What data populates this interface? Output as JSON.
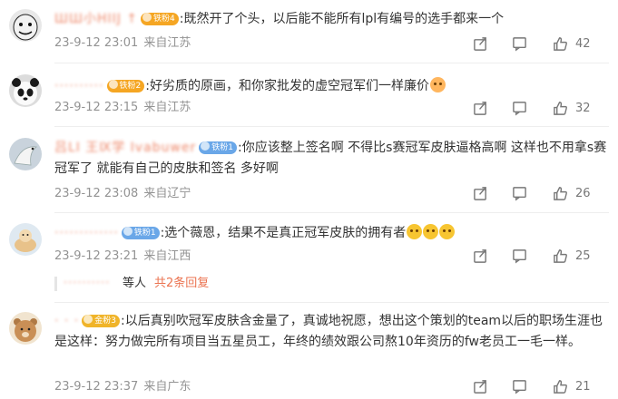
{
  "comments": [
    {
      "username": "ШШ小HIIJ ↑",
      "badge_label": "铁粉4",
      "badge_color": "#f5a623",
      "text": ":既然开了个头，以后能不能所有lpl有编号的选手都来一个",
      "time": "23-9-12 23:01",
      "location": "来自江苏",
      "likes": "42",
      "avatar_icon": "meme-face-avatar"
    },
    {
      "username": "··········",
      "badge_label": "铁粉2",
      "badge_color": "#f5a623",
      "text": ":好劣质的原画，和你家批发的虚空冠军们一样廉价",
      "emoji": "blush-emoji",
      "time": "23-9-12 23:15",
      "location": "来自江苏",
      "likes": "32",
      "avatar_icon": "panda-avatar"
    },
    {
      "username": "吕LI 王Ⅸ学 Ivabuwer",
      "badge_label": "铁粉1",
      "badge_color": "#6aa7e8",
      "text": ":你应该整上签名啊 不得比s赛冠军皮肤逼格高啊  这样也不用拿s赛冠军了 就能有自己的皮肤和签名 多好啊",
      "time": "23-9-12 23:08",
      "location": "来自辽宁",
      "likes": "26",
      "avatar_icon": "bird-avatar"
    },
    {
      "username": "·············",
      "badge_label": "铁粉1",
      "badge_color": "#6aa7e8",
      "text": ":选个薇恩，结果不是真正冠军皮肤的拥有者",
      "emoji_count": 3,
      "time": "23-9-12 23:21",
      "location": "来自江西",
      "likes": "25",
      "avatar_icon": "cartoon-avatar"
    },
    {
      "username": "·   ·   ·",
      "badge_label": "金粉3",
      "badge_color": "#f0b429",
      "text": ":以后真别吹冠军皮肤含金量了，真诚地祝愿，想出这个策划的team以后的职场生涯也是这样：努力做完所有项目当五星员工，年终的绩效跟公司熬10年资历的fw老员工一毛一样。",
      "time": "23-9-12 23:37",
      "location": "来自广东",
      "likes": "21",
      "avatar_icon": "bear-avatar"
    }
  ],
  "reply_summary": {
    "names": "··········",
    "others": "等人",
    "more_label": "共2条回复"
  }
}
